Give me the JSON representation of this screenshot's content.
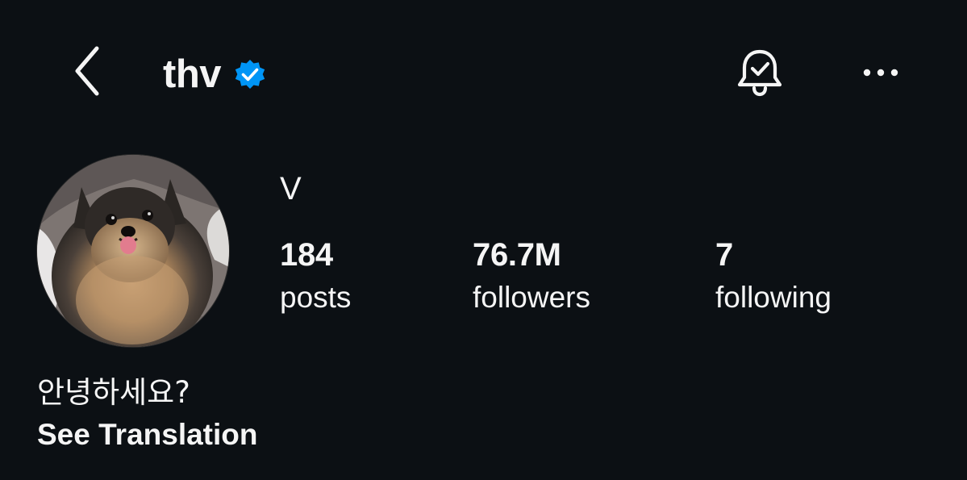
{
  "header": {
    "username": "thv",
    "back_icon": "chevron-left-icon",
    "verified_icon": "verified-badge-icon",
    "bell_icon": "notification-bell-check-icon",
    "more_icon": "more-horizontal-icon"
  },
  "profile": {
    "display_name": "V",
    "avatar_icon": "profile-photo-pomeranian",
    "stats": [
      {
        "value": "184",
        "label": "posts"
      },
      {
        "value": "76.7M",
        "label": "followers"
      },
      {
        "value": "7",
        "label": "following"
      }
    ],
    "bio": "안녕하세요?",
    "see_translation": "See Translation"
  },
  "colors": {
    "background": "#0c1014",
    "text": "#f5f5f5",
    "verified_badge": "#0095f6"
  }
}
